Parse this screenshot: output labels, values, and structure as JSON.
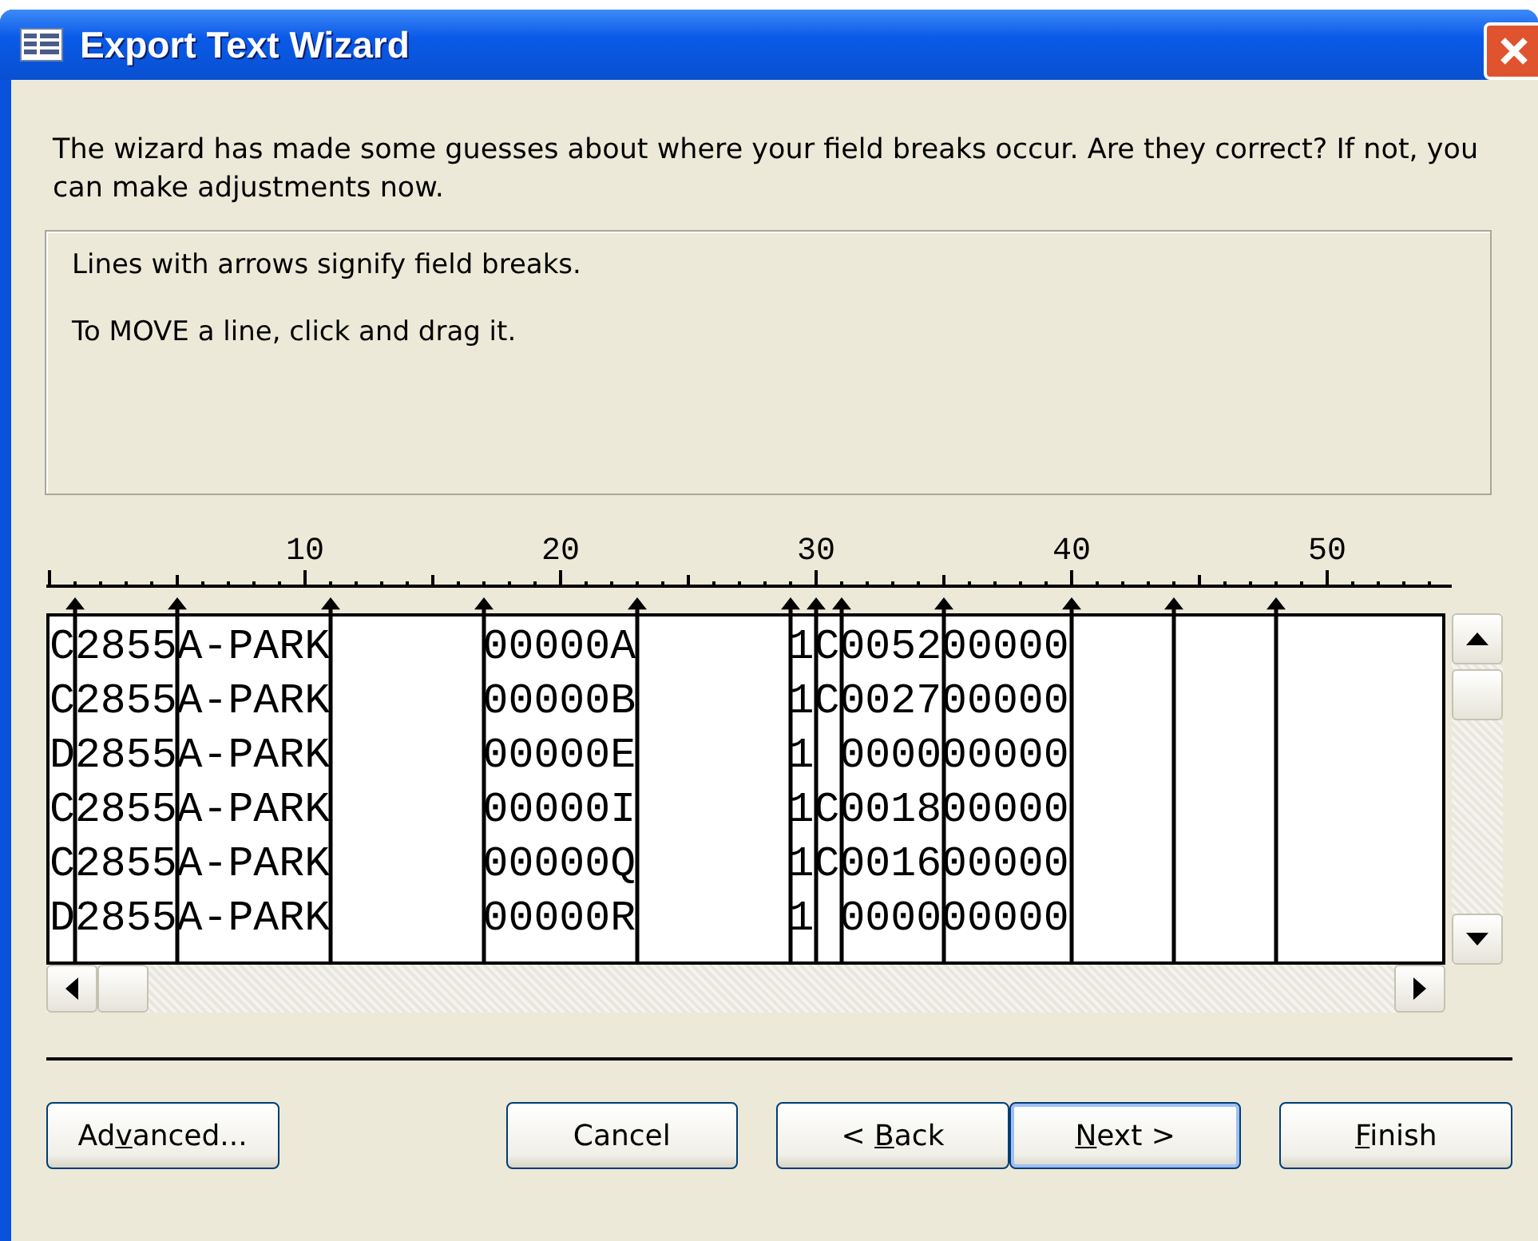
{
  "window": {
    "title": "Export Text Wizard"
  },
  "instructions": "The wizard has made some guesses about where your field breaks occur. Are they correct? If not, you can make adjustments now.",
  "hints": [
    "Lines with arrows signify field breaks.",
    "To MOVE a line, click and drag it."
  ],
  "ruler_labels": [
    "10",
    "20",
    "30",
    "40",
    "50"
  ],
  "rows": [
    [
      "C",
      "2855",
      "A-PARK",
      "      ",
      "00000A",
      "      ",
      "1",
      "C",
      "0052",
      "00000",
      "    ",
      "    ",
      "      "
    ],
    [
      "C",
      "2855",
      "A-PARK",
      "      ",
      "00000B",
      "      ",
      "1",
      "C",
      "0027",
      "00000",
      "    ",
      "    ",
      "      "
    ],
    [
      "D",
      "2855",
      "A-PARK",
      "      ",
      "00000E",
      "      ",
      "1",
      " ",
      "0000",
      "00000",
      "    ",
      "    ",
      "      "
    ],
    [
      "C",
      "2855",
      "A-PARK",
      "      ",
      "00000I",
      "      ",
      "1",
      "C",
      "0018",
      "00000",
      "    ",
      "    ",
      "      "
    ],
    [
      "C",
      "2855",
      "A-PARK",
      "      ",
      "00000Q",
      "      ",
      "1",
      "C",
      "0016",
      "00000",
      "    ",
      "    ",
      "      "
    ],
    [
      "D",
      "2855",
      "A-PARK",
      "      ",
      "00000R",
      "      ",
      "1",
      " ",
      "0000",
      "00000",
      "    ",
      "    ",
      "      "
    ]
  ],
  "buttons": [
    {
      "kind": "left",
      "label": {
        "before": "Ad",
        "key": "v",
        "after": "anced..."
      },
      "default": false
    },
    {
      "kind": "right",
      "label": {
        "after": "Cancel"
      },
      "default": false
    },
    {
      "kind": "right",
      "label": {
        "before": "< ",
        "key": "B",
        "after": "ack"
      },
      "default": false
    },
    {
      "kind": "joined",
      "label": {
        "key": "N",
        "after": "ext >"
      },
      "default": true
    },
    {
      "kind": "right",
      "label": {
        "key": "F",
        "after": "inish"
      },
      "default": false
    }
  ]
}
